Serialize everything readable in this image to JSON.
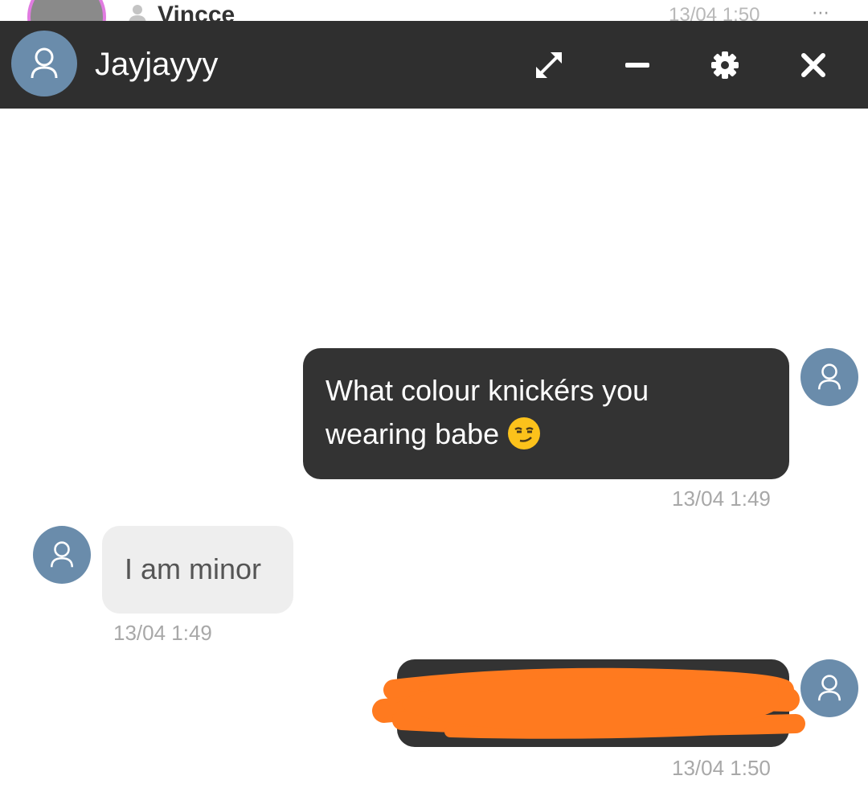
{
  "background_list": {
    "name": "Vincce",
    "time": "13/04 1:50",
    "more": "⋯"
  },
  "chat_window": {
    "contact_name": "Jayjayyy",
    "controls": {
      "expand": "expand-icon",
      "minimize": "minimize-icon",
      "settings": "gear-icon",
      "close": "close-icon"
    }
  },
  "messages": [
    {
      "direction": "outgoing",
      "text": "What colour knickérs you wearing babe",
      "line1": "What colour knickérs you",
      "line2": "wearing babe",
      "emoji": "smirking-face",
      "time": "13/04 1:49"
    },
    {
      "direction": "incoming",
      "text": "I am minor",
      "time": "13/04 1:49"
    },
    {
      "direction": "outgoing",
      "text": "",
      "redacted": true,
      "time": "13/04 1:50"
    }
  ],
  "colors": {
    "header_bg": "#2f2f2f",
    "avatar_bg": "#6a8cab",
    "outgoing_bubble": "#333333",
    "incoming_bubble": "#eeeeee",
    "redaction_scribble": "#ff7a1f",
    "timestamp": "#a8a8a8"
  }
}
